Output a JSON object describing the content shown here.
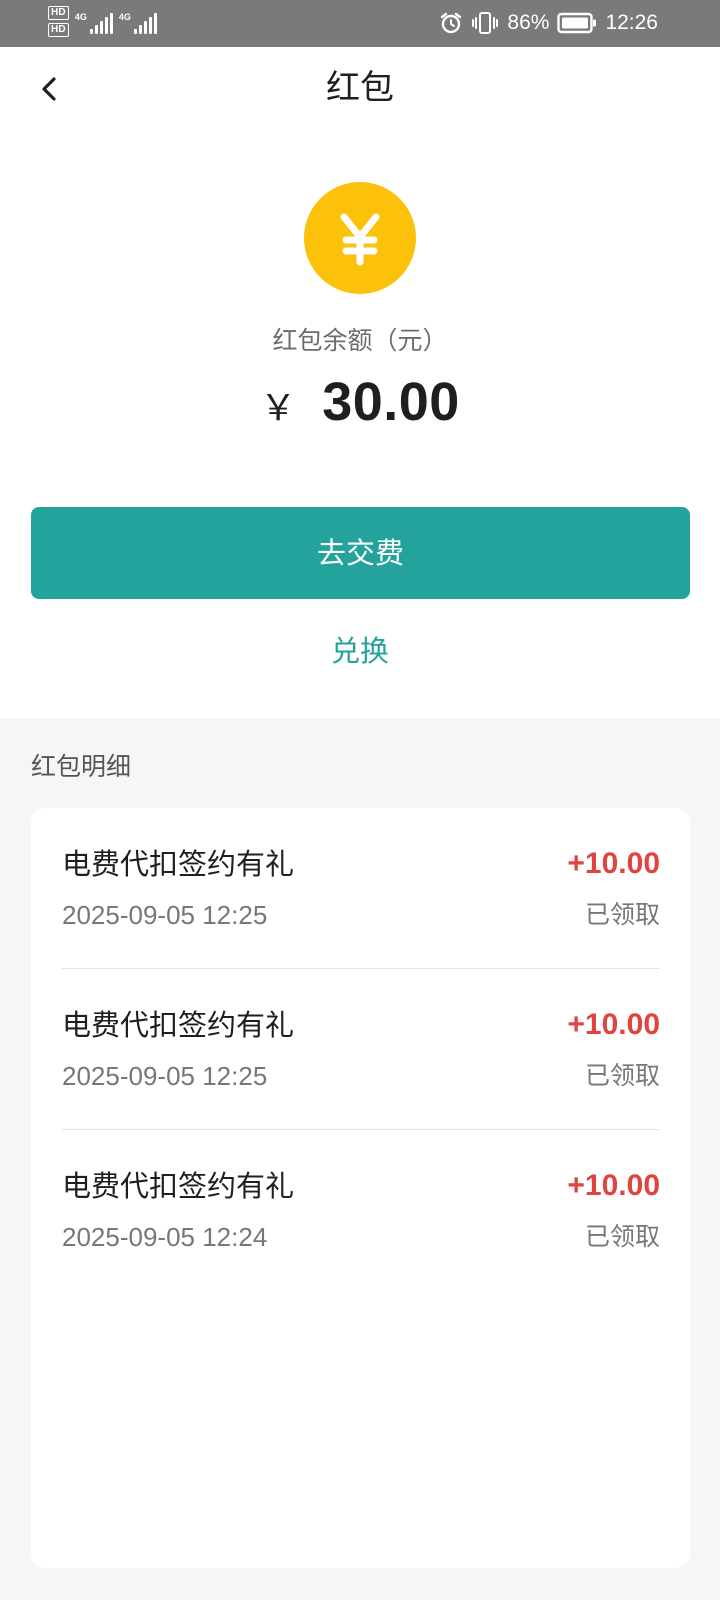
{
  "status_bar": {
    "sim_badges": [
      "HD",
      "HD"
    ],
    "network_labels": [
      "4G",
      "4G"
    ],
    "battery": "86%",
    "time": "12:26",
    "icons": [
      "signal-icon",
      "alarm-icon",
      "vibrate-icon",
      "battery-icon"
    ]
  },
  "header": {
    "title": "红包",
    "back_icon": "chevron-left-icon"
  },
  "balance": {
    "icon": "yuan-coin-icon",
    "label": "红包余额（元）",
    "currency_symbol": "￥",
    "amount": "30.00"
  },
  "actions": {
    "pay_label": "去交费",
    "exchange_label": "兑换"
  },
  "details": {
    "title": "红包明细",
    "records": [
      {
        "title": "电费代扣签约有礼",
        "amount": "+10.00",
        "time": "2025-09-05 12:25",
        "status": "已领取"
      },
      {
        "title": "电费代扣签约有礼",
        "amount": "+10.00",
        "time": "2025-09-05 12:25",
        "status": "已领取"
      },
      {
        "title": "电费代扣签约有礼",
        "amount": "+10.00",
        "time": "2025-09-05 12:24",
        "status": "已领取"
      }
    ]
  },
  "colors": {
    "accent": "#23a39c",
    "coin": "#fcc10a",
    "amount_positive": "#e0443e",
    "status_bar": "#7a7a7a",
    "page_background": "#f5f6f8"
  }
}
